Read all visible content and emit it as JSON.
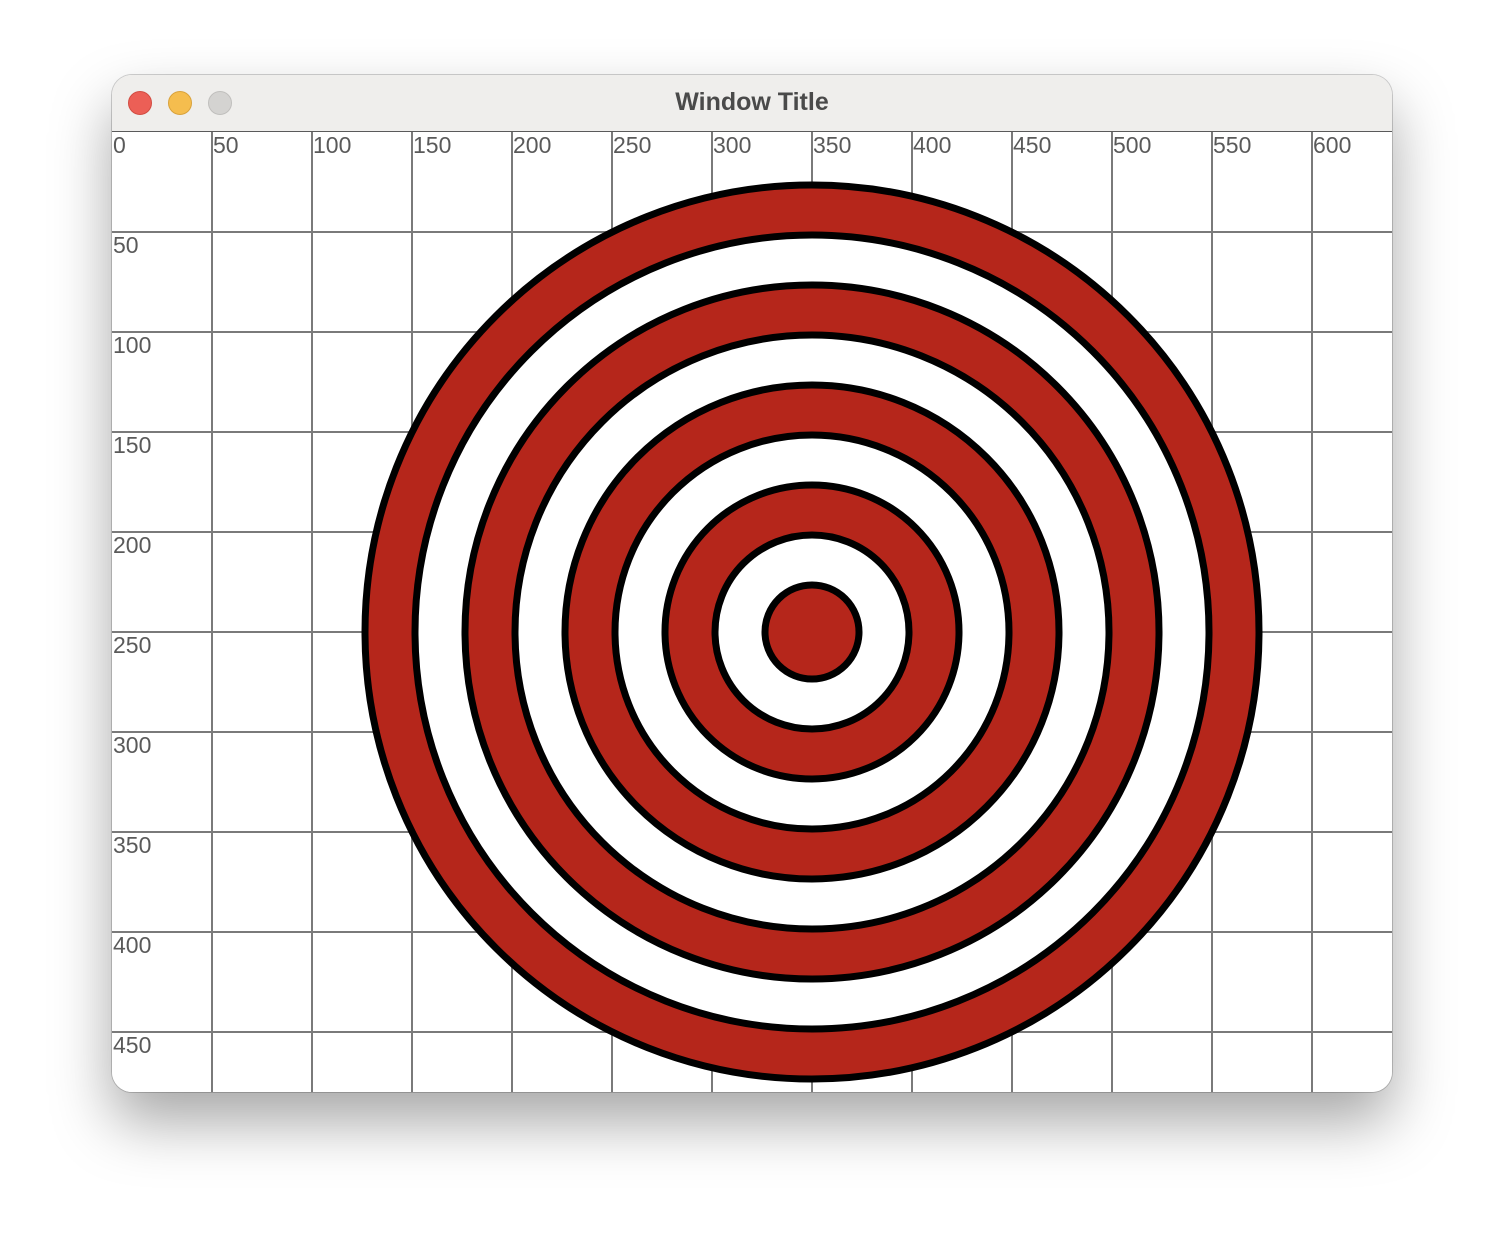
{
  "window": {
    "title": "Window Title"
  },
  "toolbar": {
    "close_icon": "close-icon",
    "minimize_icon": "minimize-icon",
    "zoom_icon": "zoom-icon"
  },
  "grid": {
    "x_ticks": [
      "0",
      "50",
      "100",
      "150",
      "200",
      "250",
      "300",
      "350",
      "400",
      "450",
      "500",
      "550",
      "600"
    ],
    "y_ticks": [
      "50",
      "100",
      "150",
      "200",
      "250",
      "300",
      "350",
      "400",
      "450"
    ],
    "step": 50,
    "line_color": "#7a7a7a"
  },
  "target": {
    "center": [
      350,
      250
    ],
    "radii": [
      225,
      200,
      175,
      150,
      125,
      100,
      75,
      50,
      25
    ],
    "ring_colors": [
      "#b5261b",
      "#ffffff",
      "#b5261b",
      "#ffffff",
      "#b5261b",
      "#ffffff",
      "#b5261b",
      "#ffffff",
      "#b5261b"
    ],
    "outline_color": "#000000"
  }
}
